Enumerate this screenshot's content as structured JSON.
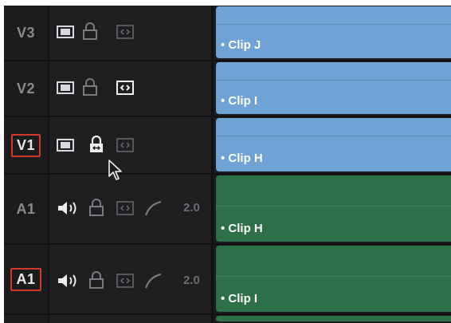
{
  "tracks": [
    {
      "id": "V3",
      "type": "video",
      "selected": false,
      "clip": "• Clip J"
    },
    {
      "id": "V2",
      "type": "video",
      "selected": false,
      "clip": "• Clip I"
    },
    {
      "id": "V1",
      "type": "video",
      "selected": true,
      "clip": "• Clip H"
    },
    {
      "id": "A1",
      "type": "audio",
      "selected": false,
      "clip": "• Clip H",
      "channels": "2.0"
    },
    {
      "id": "A1",
      "type": "audio",
      "selected": true,
      "clip": "• Clip I",
      "channels": "2.0"
    }
  ],
  "icons": {
    "film": "film-strip-icon",
    "lock": "lock-icon",
    "auto_select": "auto-select-icon",
    "speaker": "speaker-icon",
    "curve": "curve-icon",
    "cursor": "mouse-pointer-icon"
  },
  "colors": {
    "video_clip": "#6fa3d4",
    "audio_clip": "#2e7048",
    "selected_border": "#d33a2c",
    "background": "#1c1c1e"
  }
}
